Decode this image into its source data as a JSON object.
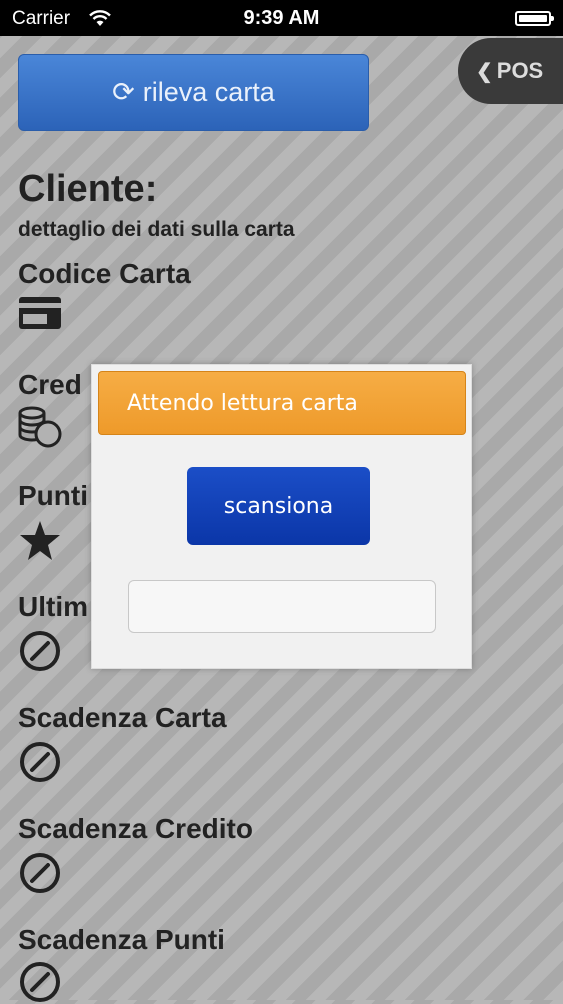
{
  "status_bar": {
    "carrier": "Carrier",
    "time": "9:39 AM"
  },
  "toolbar": {
    "detect_label": "rileva carta",
    "pos_label": "POS"
  },
  "customer": {
    "title": "Cliente:",
    "subtitle": "dettaglio dei dati sulla carta",
    "fields": [
      {
        "label": "Codice Carta",
        "icon": "credit-card-icon"
      },
      {
        "label": "Cred",
        "icon": "coins-icon"
      },
      {
        "label": "Punti",
        "icon": "star-icon"
      },
      {
        "label": "Ultim",
        "icon": "clock-icon"
      },
      {
        "label": "Scadenza Carta",
        "icon": "clock-icon"
      },
      {
        "label": "Scadenza Credito",
        "icon": "clock-icon"
      },
      {
        "label": "Scadenza Punti",
        "icon": "clock-icon"
      }
    ]
  },
  "modal": {
    "header": "Attendo lettura carta",
    "scan_label": "scansiona",
    "input_value": "",
    "input_placeholder": ""
  },
  "colors": {
    "accent_orange": "#f0a030",
    "accent_blue": "#0d3cb0",
    "detect_blue": "#3a74c8"
  }
}
